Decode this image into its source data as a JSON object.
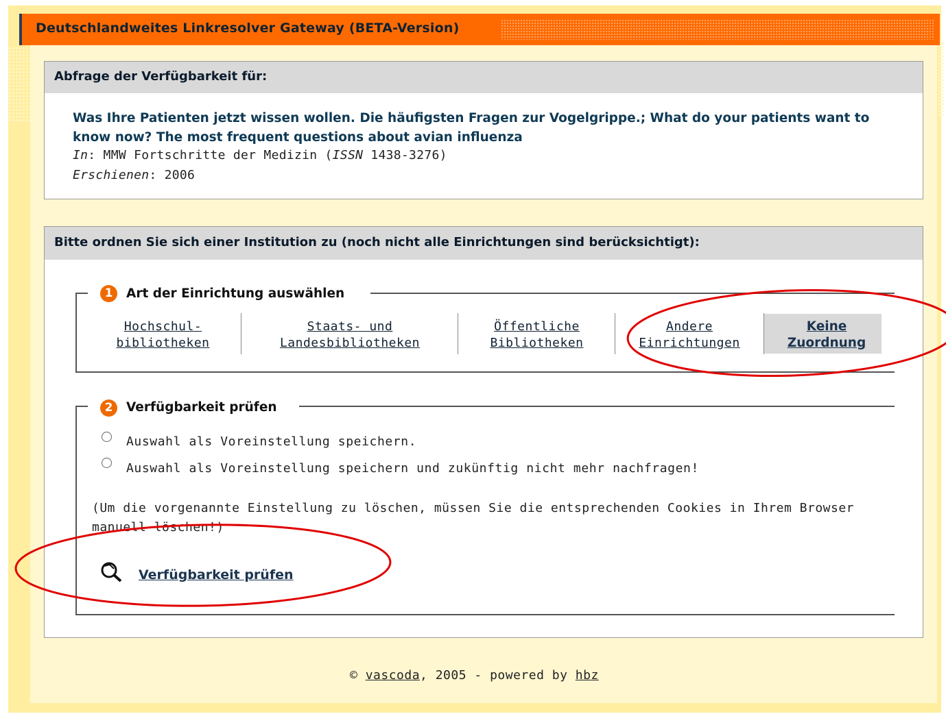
{
  "header": {
    "title": "Deutschlandweites Linkresolver Gateway  (BETA-Version)"
  },
  "availability": {
    "heading": "Abfrage der Verfügbarkeit für:",
    "article_title": "Was Ihre Patienten jetzt wissen wollen. Die häufigsten Fragen zur Vogelgrippe.; What do your patients want to know now? The most frequent questions about avian influenza",
    "in_label": "In",
    "journal_pre": ": MMW Fortschritte der Medizin (",
    "issn_label": "ISSN",
    "issn_value": " 1438-3276)",
    "published_label": "Erschienen",
    "published_value": ": 2006"
  },
  "institution": {
    "heading": "Bitte ordnen Sie sich einer Institution zu (noch nicht alle Einrichtungen sind berücksichtigt):",
    "step1": {
      "number": "1",
      "label": "Art der Einrichtung auswählen",
      "options": [
        {
          "line1": "Hochschul-",
          "line2": "bibliotheken"
        },
        {
          "line1": "Staats- und",
          "line2": "Landesbibliotheken"
        },
        {
          "line1": "Öffentliche",
          "line2": "Bibliotheken"
        },
        {
          "line1": "Andere",
          "line2": "Einrichtungen"
        },
        {
          "line1": "Keine",
          "line2": "Zuordnung"
        }
      ]
    },
    "step2": {
      "number": "2",
      "label": "Verfügbarkeit prüfen",
      "radio1": "Auswahl als Voreinstellung speichern.",
      "radio2": "Auswahl als Voreinstellung speichern und zukünftig nicht mehr nachfragen!",
      "note": "(Um die vorgenannte Einstellung zu löschen, müssen Sie die entsprechenden Cookies in Ihrem Browser manuell löschen!)",
      "check_link": "Verfügbarkeit prüfen"
    }
  },
  "footer": {
    "copyright": "© ",
    "vascoda": "vascoda",
    "middle": ", 2005 - powered by ",
    "hbz": "hbz"
  },
  "colors": {
    "header": "#ff6a00",
    "background": "#ffeea0",
    "annotation": "#e00000"
  }
}
